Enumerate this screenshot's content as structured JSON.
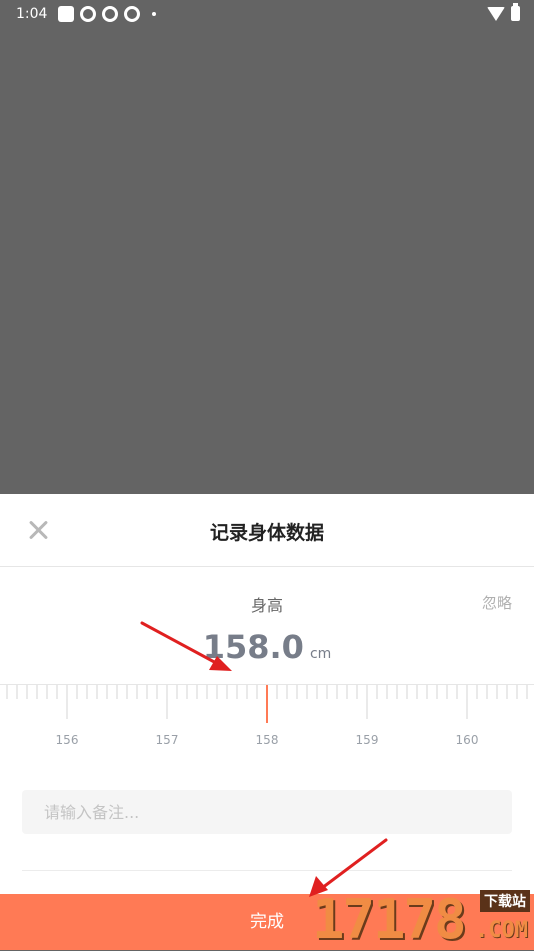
{
  "status_bar": {
    "time": "1:04"
  },
  "sheet": {
    "title": "记录身体数据",
    "metric_label": "身高",
    "ignore_label": "忽略",
    "value": "158.0",
    "unit": "cm",
    "ruler_labels": [
      "156",
      "157",
      "158",
      "159",
      "160"
    ],
    "note_placeholder": "请输入备注...",
    "note_value": "",
    "done_label": "完成"
  },
  "watermark": {
    "number": "17178",
    "download_label": "下载站",
    "domain": ".COM"
  },
  "colors": {
    "accent": "#ff7a55",
    "ruler_indicator": "#ff7a55",
    "arrow": "#e02020"
  }
}
